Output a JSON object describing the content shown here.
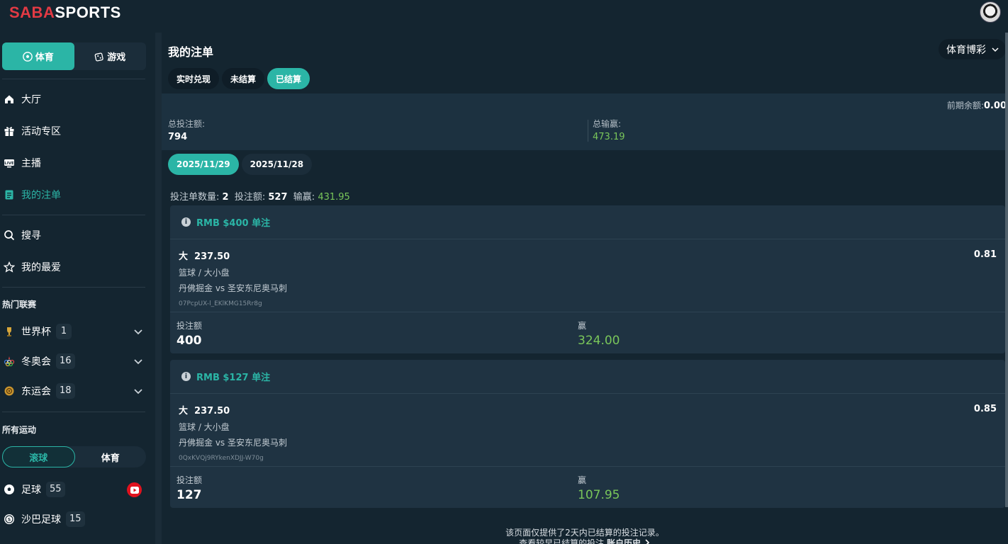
{
  "logo": {
    "part1": "SABA",
    "part2": "SPORTS"
  },
  "sidebar": {
    "switch": [
      {
        "label": "体育",
        "active": true
      },
      {
        "label": "游戏",
        "active": false
      }
    ],
    "nav": [
      {
        "label": "大厅",
        "icon": "home-icon"
      },
      {
        "label": "活动专区",
        "icon": "gift-icon"
      },
      {
        "label": "主播",
        "icon": "live-tv-icon"
      },
      {
        "label": "我的注单",
        "icon": "bet-slip-icon",
        "active": true
      }
    ],
    "nav2": [
      {
        "label": "搜寻",
        "icon": "search-icon"
      },
      {
        "label": "我的最爱",
        "icon": "star-icon"
      }
    ],
    "hot_title": "热门联赛",
    "leagues": [
      {
        "label": "世界杯",
        "count": "1"
      },
      {
        "label": "冬奥会",
        "count": "16"
      },
      {
        "label": "东运会",
        "count": "18"
      }
    ],
    "all_title": "所有运动",
    "live_toggle": [
      {
        "label": "滚球",
        "active": true
      },
      {
        "label": "体育",
        "active": false
      }
    ],
    "sports": [
      {
        "label": "足球",
        "count": "55"
      },
      {
        "label": "沙巴足球",
        "count": "15"
      }
    ]
  },
  "main": {
    "title": "我的注单",
    "sport_select": "体育博彩",
    "tabs": [
      {
        "label": "实时兑现",
        "active": false
      },
      {
        "label": "未结算",
        "active": false
      },
      {
        "label": "已结算",
        "active": true
      }
    ],
    "prev_balance_label": "前期余额:",
    "prev_balance_value": "0.00",
    "total_stake_label": "总投注额:",
    "total_stake_value": "794",
    "total_win_label": "总输赢:",
    "total_win_value": "473.19",
    "dates": [
      {
        "label": "2025/11/29",
        "active": true
      },
      {
        "label": "2025/11/28",
        "active": false
      }
    ],
    "stats": {
      "count_label": "投注单数量:",
      "count_value": "2",
      "stake_label": "投注额:",
      "stake_value": "527",
      "win_label": "输赢:",
      "win_value": "431.95"
    },
    "bets": [
      {
        "header": "RMB $400 单注",
        "selection": "大  237.50",
        "odds": "0.81",
        "market": "篮球 / 大小盘",
        "match": "丹佛掘金 vs 圣安东尼奥马刺",
        "ticket_id": "07PcpUX-l_EKlKMG15Rr8g",
        "stake_label": "投注额",
        "stake": "400",
        "result_label": "赢",
        "result": "324.00"
      },
      {
        "header": "RMB $127 单注",
        "selection": "大  237.50",
        "odds": "0.85",
        "market": "篮球 / 大小盘",
        "match": "丹佛掘金 vs 圣安东尼奥马刺",
        "ticket_id": "0QxKVQj9RYkenXDJJ-W70g",
        "stake_label": "投注额",
        "stake": "127",
        "result_label": "赢",
        "result": "107.95"
      }
    ],
    "note_line1": "该页面仅提供了2天内已结算的投注记录。",
    "note_line2_prefix": "查看较早已结算的投注",
    "note_line2_link": "账户历史"
  },
  "colors": {
    "accent": "#2bb5a6",
    "win": "#79c65a",
    "brand_red": "#e23a44"
  }
}
